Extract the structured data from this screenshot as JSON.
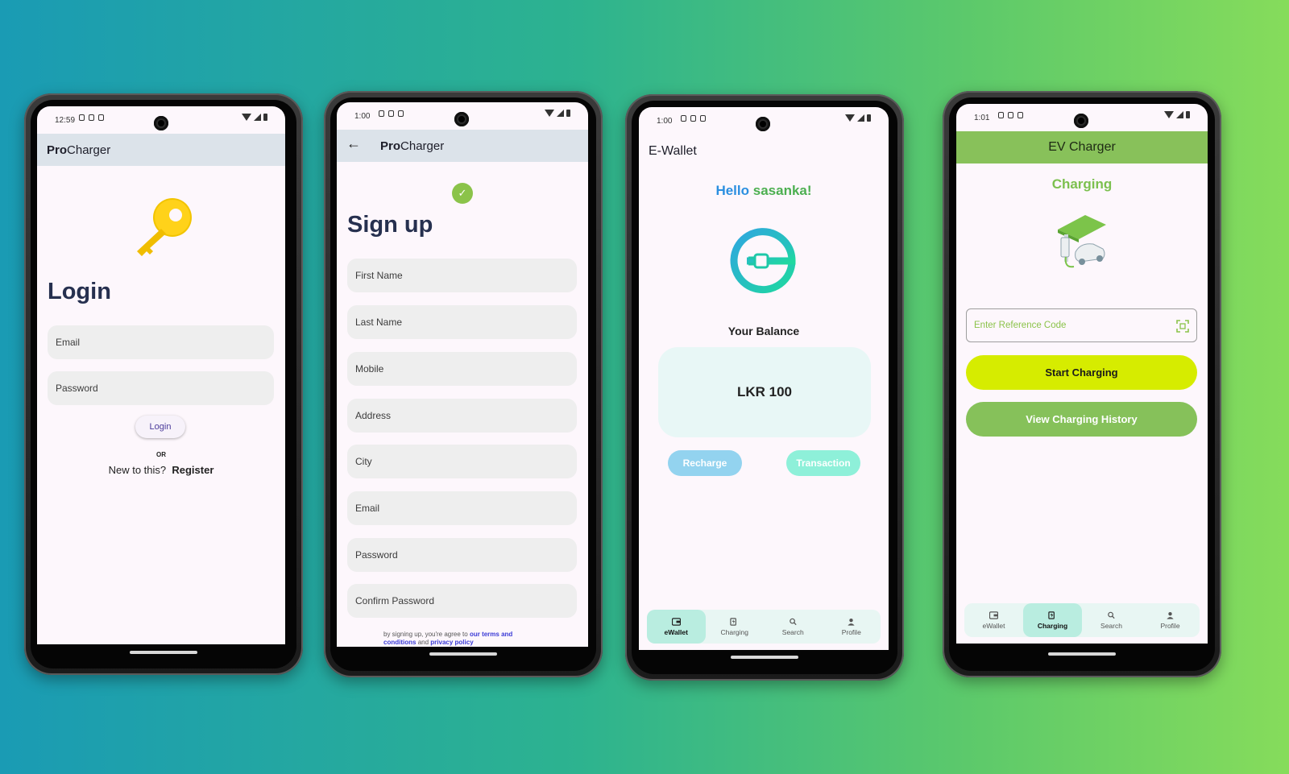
{
  "screens": {
    "login": {
      "time": "12:59",
      "app_title_bold": "Pro",
      "app_title_rest": "Charger",
      "heading": "Login",
      "email_placeholder": "Email",
      "password_placeholder": "Password",
      "login_button": "Login",
      "or_text": "OR",
      "new_text": "New to this?",
      "register_link": "Register"
    },
    "signup": {
      "time": "1:00",
      "app_title_bold": "Pro",
      "app_title_rest": "Charger",
      "heading": "Sign up",
      "fields": [
        "First Name",
        "Last Name",
        "Mobile",
        "Address",
        "City",
        "Email",
        "Password",
        "Confirm Password"
      ],
      "terms_prefix": "by signing up, you're agree to",
      "terms_link": "our terms and conditions",
      "terms_and": "and",
      "privacy_link": "privacy policy"
    },
    "wallet": {
      "time": "1:00",
      "app_title": "E-Wallet",
      "hello": "Hello",
      "username": "sasanka!",
      "balance_label": "Your Balance",
      "balance_value": "LKR 100",
      "recharge_button": "Recharge",
      "transaction_button": "Transaction",
      "nav": [
        "eWallet",
        "Charging",
        "Search",
        "Profile"
      ]
    },
    "charger": {
      "time": "1:01",
      "app_title": "EV Charger",
      "heading": "Charging",
      "reference_placeholder": "Enter Reference Code",
      "start_button": "Start Charging",
      "history_button": "View Charging History",
      "nav": [
        "eWallet",
        "Charging",
        "Search",
        "Profile"
      ]
    }
  },
  "colors": {
    "accent_blue": "#2b8fe0",
    "accent_green": "#4caf50",
    "lime": "#d6ec00",
    "charger_green": "#88c15a",
    "teal_logo": "#1fc8a8"
  }
}
